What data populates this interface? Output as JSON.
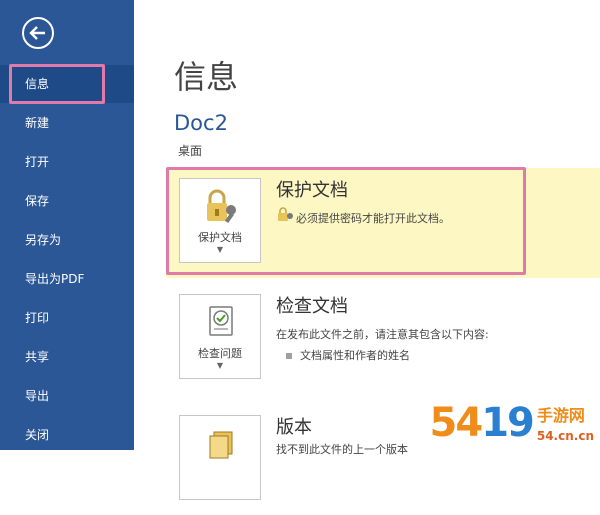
{
  "sidebar": {
    "items": [
      {
        "label": "信息"
      },
      {
        "label": "新建"
      },
      {
        "label": "打开"
      },
      {
        "label": "保存"
      },
      {
        "label": "另存为"
      },
      {
        "label": "导出为PDF"
      },
      {
        "label": "打印"
      },
      {
        "label": "共享"
      },
      {
        "label": "导出"
      },
      {
        "label": "关闭"
      }
    ]
  },
  "main": {
    "title": "信息",
    "doc_name": "Doc2",
    "doc_location": "桌面",
    "protect": {
      "button_label": "保护文档",
      "title": "保护文档",
      "desc": "必须提供密码才能打开此文档。"
    },
    "inspect": {
      "button_label": "检查问题",
      "title": "检查文档",
      "desc": "在发布此文件之前，请注意其包含以下内容:",
      "bullet": "文档属性和作者的姓名"
    },
    "versions": {
      "title": "版本",
      "desc": "找不到此文件的上一个版本"
    }
  },
  "watermark": {
    "number": "54",
    "suffix": "19",
    "text": "手游网",
    "domain": "54.cn.cn"
  },
  "colors": {
    "sidebar_bg": "#2b5797",
    "accent": "#2b5797",
    "highlight_bg": "#fdf7c3",
    "annotation_border": "#e07aa8"
  }
}
